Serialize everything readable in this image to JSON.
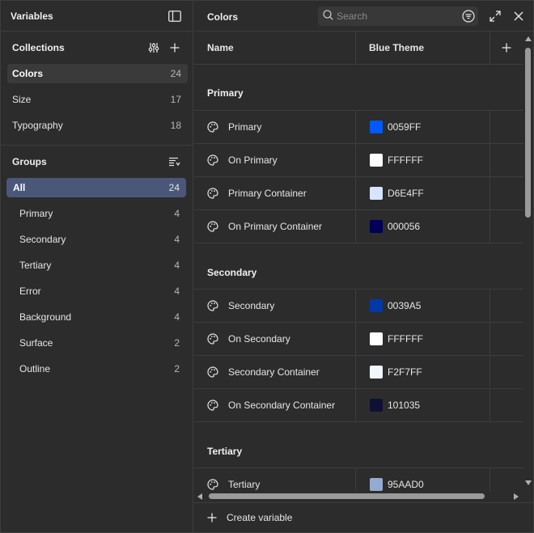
{
  "left_panel": {
    "title": "Variables",
    "collections": {
      "label": "Collections",
      "items": [
        {
          "label": "Colors",
          "count": "24"
        },
        {
          "label": "Size",
          "count": "17"
        },
        {
          "label": "Typography",
          "count": "18"
        }
      ]
    },
    "groups": {
      "label": "Groups",
      "items": [
        {
          "label": "All",
          "count": "24"
        },
        {
          "label": "Primary",
          "count": "4"
        },
        {
          "label": "Secondary",
          "count": "4"
        },
        {
          "label": "Tertiary",
          "count": "4"
        },
        {
          "label": "Error",
          "count": "4"
        },
        {
          "label": "Background",
          "count": "4"
        },
        {
          "label": "Surface",
          "count": "2"
        },
        {
          "label": "Outline",
          "count": "2"
        }
      ]
    }
  },
  "right_panel": {
    "title": "Colors",
    "search": {
      "placeholder": "Search",
      "value": ""
    },
    "table": {
      "columns": [
        "Name",
        "Blue Theme"
      ],
      "groups": [
        {
          "title": "Primary",
          "rows": [
            {
              "name": "Primary",
              "value": "0059FF",
              "color": "#0059FF"
            },
            {
              "name": "On Primary",
              "value": "FFFFFF",
              "color": "#FFFFFF"
            },
            {
              "name": "Primary Container",
              "value": "D6E4FF",
              "color": "#D6E4FF"
            },
            {
              "name": "On Primary Container",
              "value": "000056",
              "color": "#000056"
            }
          ]
        },
        {
          "title": "Secondary",
          "rows": [
            {
              "name": "Secondary",
              "value": "0039A5",
              "color": "#0039A5"
            },
            {
              "name": "On Secondary",
              "value": "FFFFFF",
              "color": "#FFFFFF"
            },
            {
              "name": "Secondary Container",
              "value": "F2F7FF",
              "color": "#F2F7FF"
            },
            {
              "name": "On Secondary Container",
              "value": "101035",
              "color": "#101035"
            }
          ]
        },
        {
          "title": "Tertiary",
          "rows": [
            {
              "name": "Tertiary",
              "value": "95AAD0",
              "color": "#95AAD0"
            }
          ]
        }
      ]
    },
    "footer": {
      "create_label": "Create variable"
    }
  },
  "icons": {
    "sidebar_toggle": "sidebar-icon",
    "variable_row": "palette-icon",
    "filter": "filter-icon",
    "expand": "expand-icon",
    "close": "close-icon"
  },
  "colors": {
    "background": "#2c2c2c",
    "selected_group": "#4b5779",
    "selected_collection": "#3a3a3a"
  }
}
